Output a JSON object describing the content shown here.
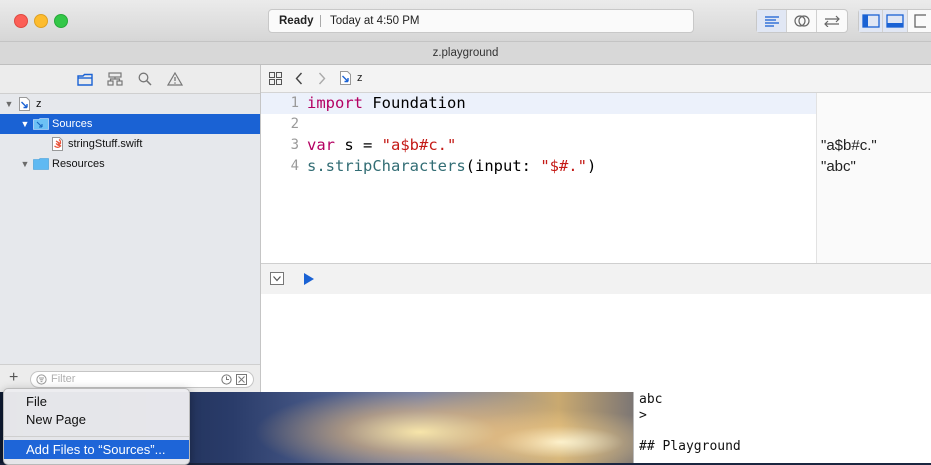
{
  "window": {
    "status": "Ready",
    "status_time": "Today at 4:50 PM",
    "tab_title": "z.playground"
  },
  "jumpbar": {
    "path_item": "z"
  },
  "navigator": {
    "items": [
      {
        "label": "z",
        "type": "playground"
      },
      {
        "label": "Sources",
        "type": "folder",
        "selected": true
      },
      {
        "label": "stringStuff.swift",
        "type": "swift-file"
      },
      {
        "label": "Resources",
        "type": "folder"
      }
    ],
    "filter_placeholder": "Filter"
  },
  "editor": {
    "lines": [
      {
        "number": "1",
        "tokens": [
          {
            "t": "import",
            "c": "kw"
          },
          {
            "t": " Foundation",
            "c": ""
          }
        ]
      },
      {
        "number": "2",
        "tokens": []
      },
      {
        "number": "3",
        "tokens": [
          {
            "t": "var",
            "c": "kw"
          },
          {
            "t": " s = ",
            "c": ""
          },
          {
            "t": "\"a$b#c.\"",
            "c": "str"
          }
        ]
      },
      {
        "number": "4",
        "tokens": [
          {
            "t": "s.",
            "c": "fn"
          },
          {
            "t": "stripCharacters",
            "c": "fn"
          },
          {
            "t": "(input: ",
            "c": ""
          },
          {
            "t": "\"$#.\"",
            "c": "str"
          },
          {
            "t": ")",
            "c": ""
          }
        ]
      }
    ],
    "results": [
      {
        "line": 3,
        "text": "\"a$b#c.\""
      },
      {
        "line": 4,
        "text": "\"abc\""
      }
    ]
  },
  "context_menu": {
    "items": [
      "File",
      "New Page",
      "Add Files to “Sources”..."
    ],
    "highlighted": "Add Files to “Sources”..."
  },
  "terminal": {
    "lines": [
      "abc",
      ">",
      "",
      "## Playground"
    ]
  },
  "colors": {
    "selection": "#1a62d4",
    "keyword": "#b40062",
    "string": "#c41a16",
    "function": "#326d74"
  }
}
